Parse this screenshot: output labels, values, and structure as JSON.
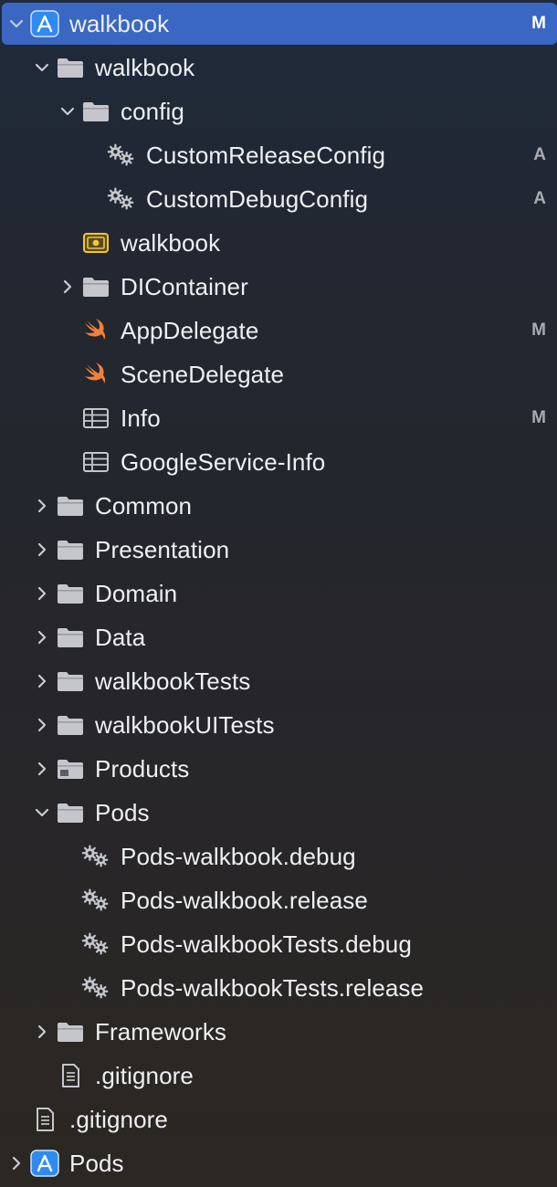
{
  "navigator": {
    "items": [
      {
        "label": "walkbook",
        "icon": "xcode-project-icon",
        "depth": 0,
        "chevron": "open",
        "status": "M",
        "selected": true
      },
      {
        "label": "walkbook",
        "icon": "folder-icon",
        "depth": 1,
        "chevron": "open",
        "status": ""
      },
      {
        "label": "config",
        "icon": "folder-icon",
        "depth": 2,
        "chevron": "open",
        "status": ""
      },
      {
        "label": "CustomReleaseConfig",
        "icon": "gear-config-icon",
        "depth": 3,
        "chevron": "none",
        "status": "A"
      },
      {
        "label": "CustomDebugConfig",
        "icon": "gear-config-icon",
        "depth": 3,
        "chevron": "none",
        "status": "A"
      },
      {
        "label": "walkbook",
        "icon": "entitlements-icon",
        "depth": 2,
        "chevron": "none",
        "status": ""
      },
      {
        "label": "DIContainer",
        "icon": "folder-icon",
        "depth": 2,
        "chevron": "closed",
        "status": ""
      },
      {
        "label": "AppDelegate",
        "icon": "swift-icon",
        "depth": 2,
        "chevron": "none",
        "status": "M"
      },
      {
        "label": "SceneDelegate",
        "icon": "swift-icon",
        "depth": 2,
        "chevron": "none",
        "status": ""
      },
      {
        "label": "Info",
        "icon": "plist-icon",
        "depth": 2,
        "chevron": "none",
        "status": "M"
      },
      {
        "label": "GoogleService-Info",
        "icon": "plist-icon",
        "depth": 2,
        "chevron": "none",
        "status": ""
      },
      {
        "label": "Common",
        "icon": "folder-icon",
        "depth": 1,
        "chevron": "closed",
        "status": ""
      },
      {
        "label": "Presentation",
        "icon": "folder-icon",
        "depth": 1,
        "chevron": "closed",
        "status": ""
      },
      {
        "label": "Domain",
        "icon": "folder-icon",
        "depth": 1,
        "chevron": "closed",
        "status": ""
      },
      {
        "label": "Data",
        "icon": "folder-icon",
        "depth": 1,
        "chevron": "closed",
        "status": ""
      },
      {
        "label": "walkbookTests",
        "icon": "folder-icon",
        "depth": 1,
        "chevron": "closed",
        "status": ""
      },
      {
        "label": "walkbookUITests",
        "icon": "folder-icon",
        "depth": 1,
        "chevron": "closed",
        "status": ""
      },
      {
        "label": "Products",
        "icon": "products-folder-icon",
        "depth": 1,
        "chevron": "closed",
        "status": ""
      },
      {
        "label": "Pods",
        "icon": "folder-icon",
        "depth": 1,
        "chevron": "open",
        "status": ""
      },
      {
        "label": "Pods-walkbook.debug",
        "icon": "gear-config-icon",
        "depth": 2,
        "chevron": "none",
        "status": ""
      },
      {
        "label": "Pods-walkbook.release",
        "icon": "gear-config-icon",
        "depth": 2,
        "chevron": "none",
        "status": ""
      },
      {
        "label": "Pods-walkbookTests.debug",
        "icon": "gear-config-icon",
        "depth": 2,
        "chevron": "none",
        "status": ""
      },
      {
        "label": "Pods-walkbookTests.release",
        "icon": "gear-config-icon",
        "depth": 2,
        "chevron": "none",
        "status": ""
      },
      {
        "label": "Frameworks",
        "icon": "folder-icon",
        "depth": 1,
        "chevron": "closed",
        "status": ""
      },
      {
        "label": ".gitignore",
        "icon": "text-file-icon",
        "depth": 1,
        "chevron": "none",
        "status": ""
      },
      {
        "label": ".gitignore",
        "icon": "text-file-icon",
        "depth": 0,
        "chevron": "none",
        "status": ""
      },
      {
        "label": "Pods",
        "icon": "xcode-project-icon",
        "depth": 0,
        "chevron": "closed",
        "status": ""
      }
    ]
  },
  "colors": {
    "selection": "#3a67c4",
    "folder": "#c4c6cb",
    "swift": "#f1813a",
    "entitlements": "#f3c53d",
    "status": "#a8abb2"
  }
}
